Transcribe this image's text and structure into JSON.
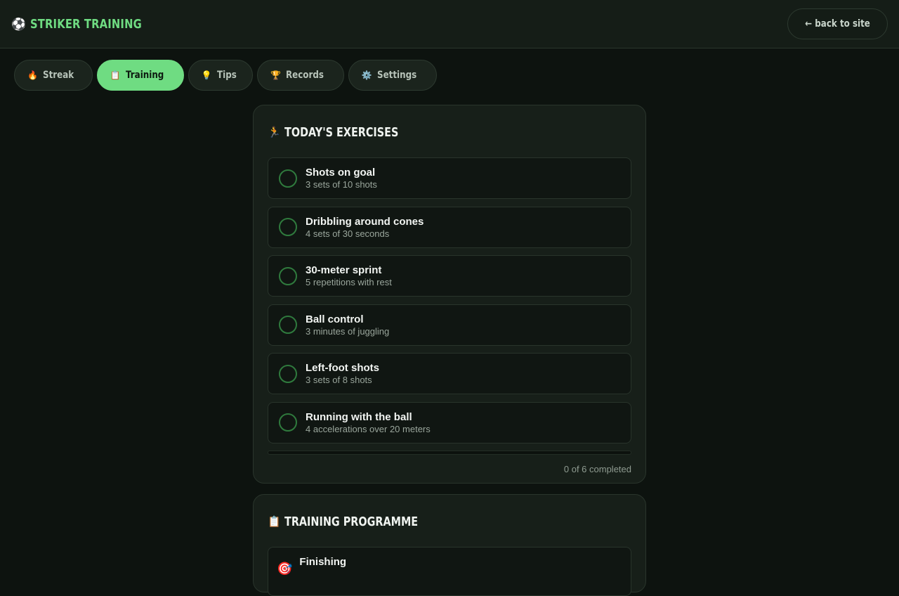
{
  "header": {
    "brand_icon": "⚽",
    "brand_title": "STRIKER TRAINING",
    "back_label": "← back to site"
  },
  "tabs": [
    {
      "icon": "🔥",
      "label": "Streak",
      "active": false
    },
    {
      "icon": "📋",
      "label": "Training",
      "active": true
    },
    {
      "icon": "💡",
      "label": "Tips",
      "active": false
    },
    {
      "icon": "🏆",
      "label": "Records",
      "active": false
    },
    {
      "icon": "⚙️",
      "label": "Settings",
      "active": false
    }
  ],
  "exercises_card": {
    "icon": "🏃",
    "title": "TODAY'S EXERCISES",
    "items": [
      {
        "name": "Shots on goal",
        "detail": "3 sets of 10 shots"
      },
      {
        "name": "Dribbling around cones",
        "detail": "4 sets of 30 seconds"
      },
      {
        "name": "30-meter sprint",
        "detail": "5 repetitions with rest"
      },
      {
        "name": "Ball control",
        "detail": "3 minutes of juggling"
      },
      {
        "name": "Left-foot shots",
        "detail": "3 sets of 8 shots"
      },
      {
        "name": "Running with the ball",
        "detail": "4 accelerations over 20 meters"
      }
    ],
    "progress_fraction": 0,
    "progress_text": "0 of 6 completed"
  },
  "programme_card": {
    "icon": "📋",
    "title": "TRAINING PROGRAMME",
    "items": [
      {
        "icon": "🎯",
        "name": "Finishing"
      }
    ]
  },
  "colors": {
    "accent": "#6fdc82",
    "background": "#0d130f",
    "card": "#171f19"
  }
}
